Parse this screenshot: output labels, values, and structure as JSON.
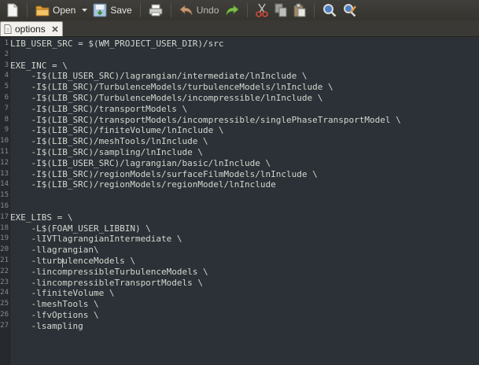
{
  "toolbar": {
    "open_label": "Open",
    "save_label": "Save",
    "undo_label": "Undo"
  },
  "tab": {
    "title": "options"
  },
  "editor": {
    "lines": [
      {
        "n": "1",
        "text": "LIB_USER_SRC = $(WM_PROJECT_USER_DIR)/src"
      },
      {
        "n": "2",
        "text": ""
      },
      {
        "n": "3",
        "text": "EXE_INC = \\"
      },
      {
        "n": "4",
        "text": "    -I$(LIB_USER_SRC)/lagrangian/intermediate/lnInclude \\"
      },
      {
        "n": "5",
        "text": "    -I$(LIB_SRC)/TurbulenceModels/turbulenceModels/lnInclude \\"
      },
      {
        "n": "6",
        "text": "    -I$(LIB_SRC)/TurbulenceModels/incompressible/lnInclude \\"
      },
      {
        "n": "7",
        "text": "    -I$(LIB_SRC)/transportModels \\"
      },
      {
        "n": "8",
        "text": "    -I$(LIB_SRC)/transportModels/incompressible/singlePhaseTransportModel \\"
      },
      {
        "n": "9",
        "text": "    -I$(LIB_SRC)/finiteVolume/lnInclude \\"
      },
      {
        "n": "10",
        "text": "    -I$(LIB_SRC)/meshTools/lnInclude \\"
      },
      {
        "n": "11",
        "text": "    -I$(LIB_SRC)/sampling/lnInclude \\"
      },
      {
        "n": "12",
        "text": "    -I$(LIB_USER_SRC)/lagrangian/basic/lnInclude \\"
      },
      {
        "n": "13",
        "text": "    -I$(LIB_SRC)/regionModels/surfaceFilmModels/lnInclude \\"
      },
      {
        "n": "14",
        "text": "    -I$(LIB_SRC)/regionModels/regionModel/lnInclude"
      },
      {
        "n": "15",
        "text": ""
      },
      {
        "n": "16",
        "text": ""
      },
      {
        "n": "17",
        "text": "EXE_LIBS = \\"
      },
      {
        "n": "18",
        "text": "    -L$(FOAM_USER_LIBBIN) \\"
      },
      {
        "n": "19",
        "text": "    -lIVTlagrangianIntermediate \\"
      },
      {
        "n": "20",
        "text": "    -llagrangian\\"
      },
      {
        "n": "21",
        "text": "    -lturbulenceModels \\"
      },
      {
        "n": "22",
        "text": "    -lincompressibleTurbulenceModels \\"
      },
      {
        "n": "23",
        "text": "    -lincompressibleTransportModels \\"
      },
      {
        "n": "24",
        "text": "    -lfiniteVolume \\"
      },
      {
        "n": "25",
        "text": "    -lmeshTools \\"
      },
      {
        "n": "26",
        "text": "    -lfvOptions \\"
      },
      {
        "n": "27",
        "text": "    -lsampling"
      }
    ]
  },
  "icons": {
    "new": "new-file-icon",
    "open": "open-folder-icon",
    "save": "save-icon",
    "print": "print-icon",
    "undo": "undo-icon",
    "redo": "redo-icon",
    "cut": "cut-icon",
    "copy": "copy-icon",
    "paste": "paste-icon",
    "find": "search-icon",
    "replace": "find-replace-icon",
    "tab": "document-icon",
    "close": "close-icon"
  },
  "colors": {
    "editor_bg": "#2c3137",
    "text": "#d3d7cf",
    "line_number": "#868b90",
    "toolbar_bg": "#3c3b37",
    "tab_bg": "#f2f1ee"
  }
}
